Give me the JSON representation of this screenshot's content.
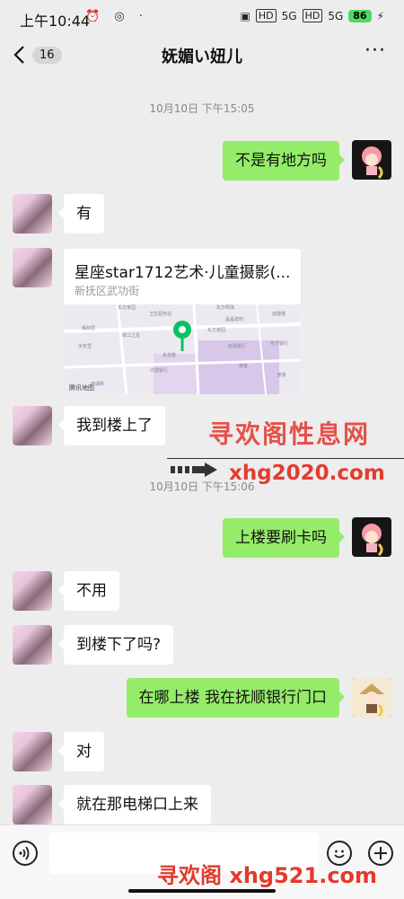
{
  "status_bar": {
    "time": "上午10:44",
    "signal_1": "5G",
    "signal_2": "5G",
    "hd_1": "HD",
    "hd_2": "HD",
    "battery": "86"
  },
  "header": {
    "back_count": "16",
    "title": "妩媚い妞儿",
    "more": "···"
  },
  "timestamps": [
    "10月10日 下午15:05",
    "10月10日 下午15:06"
  ],
  "messages": [
    {
      "from": "me",
      "text": "不是有地方吗"
    },
    {
      "from": "them",
      "text": "有"
    },
    {
      "from": "them",
      "type": "location",
      "title": "星座star1712艺术·儿童摄影(...",
      "address": "新抚区武功街"
    },
    {
      "from": "them",
      "text": "我到楼上了"
    },
    {
      "from": "me",
      "text": "上楼要刷卡吗"
    },
    {
      "from": "them",
      "text": "不用"
    },
    {
      "from": "them",
      "text": "到楼下了吗?"
    },
    {
      "from": "me",
      "text": "在哪上楼 我在抚顺银行门口"
    },
    {
      "from": "them",
      "text": "对"
    },
    {
      "from": "them",
      "text": "就在那电梯口上来"
    }
  ],
  "map": {
    "labels": [
      "东方家园",
      "卫生服务站",
      "儒林居",
      "东方明珠",
      "晶晶建材",
      "城建楼",
      "东方家园",
      "锦江之星",
      "永安里",
      "东方银行",
      "中国银行",
      "抚顺银行",
      "永吉路",
      "维景",
      "丽景",
      "西湖街"
    ],
    "credit": "腾讯地图"
  },
  "watermarks": {
    "title_cn": "寻欢阁性息网",
    "url_top": "xhg2020.com",
    "url_bottom": "寻欢阁 xhg521.com"
  },
  "colors": {
    "background": "#ededed",
    "my_bubble": "#95ec69",
    "their_bubble": "#ffffff",
    "map_pin": "#08c160"
  }
}
